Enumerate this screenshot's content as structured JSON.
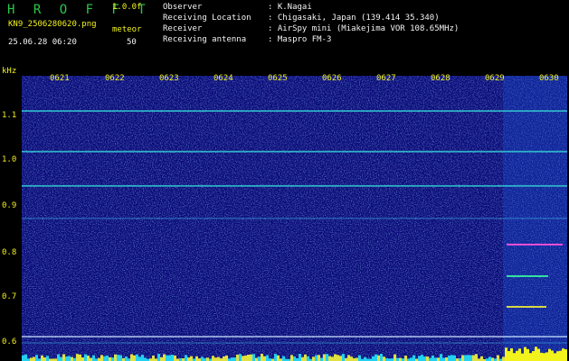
{
  "header": {
    "logo": "H R O F F T",
    "version": "1.0.0f",
    "filename": "KN9_2506280620.png",
    "meteor_label": "meteor",
    "datetime": "25.06.28 06:20",
    "count": "50",
    "fields": [
      {
        "label": "Observer",
        "value": ": K.Nagai"
      },
      {
        "label": "Receiving Location",
        "value": ": Chigasaki, Japan (139.414 35.340)"
      },
      {
        "label": "Receiver",
        "value": ": AirSpy mini (Miakejima VOR 108.65MHz)"
      },
      {
        "label": "Receiving antenna",
        "value": ": Maspro FM-3"
      }
    ]
  },
  "axis": {
    "y_unit": "kHz",
    "y_ticks": [
      "1.1",
      "1.0",
      "0.9",
      "0.8",
      "0.7",
      "0.6"
    ],
    "x_ticks": [
      "0621",
      "0622",
      "0623",
      "0624",
      "0625",
      "0626",
      "0627",
      "0628",
      "0629",
      "0630"
    ]
  },
  "colors": {
    "background": "#0a0a78",
    "tone": "#32c8d2",
    "text_yellow": "#f2f21c",
    "logo_green": "#27c94a"
  }
}
